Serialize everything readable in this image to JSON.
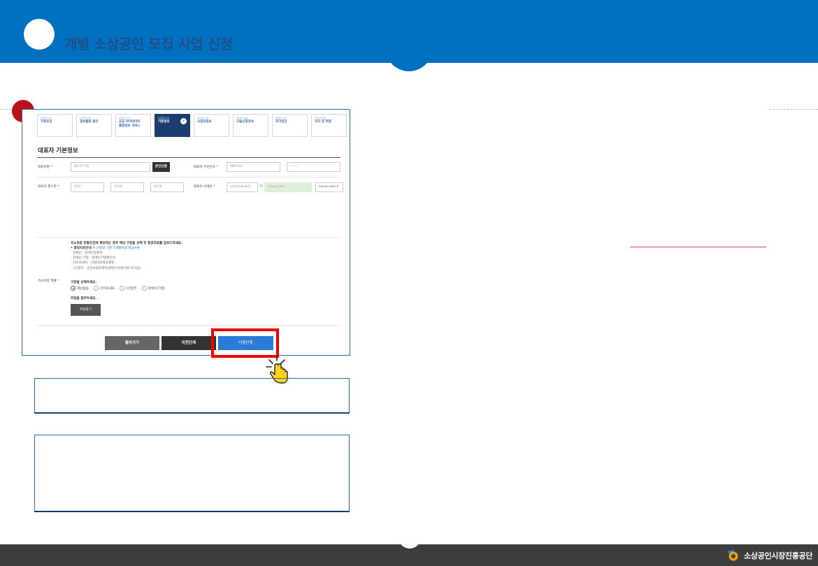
{
  "header": {
    "title": "개별 소상공인 모집 사업 신청"
  },
  "steps": [
    {
      "num": "STEP 01",
      "name": "기본요건"
    },
    {
      "num": "STEP 02",
      "name": "정보활용 동의"
    },
    {
      "num": "STEP 03",
      "name": "공공 마이데이터",
      "name2": "통합정보 서비스"
    },
    {
      "num": "STEP 04",
      "name": "기본정보"
    },
    {
      "num": "STEP 05",
      "name": "사업장정보"
    },
    {
      "num": "STEP 06",
      "name": "기술신청정보"
    },
    {
      "num": "STEP 07",
      "name": "자가진단"
    },
    {
      "num": "STEP 08",
      "name": "의지 및 역량"
    }
  ],
  "form": {
    "section_title": "대표자 기본정보",
    "name_label": "대표자명 *",
    "name_value": "테스트기업",
    "verify_button": "본인인증",
    "ssn_label": "대표자 주민번호 *",
    "ssn_front": "980702",
    "ssn_back": "-------",
    "phone_label": "대표자 핸드폰 *",
    "phone_1": "010",
    "phone_2": "1234",
    "phone_3": "5678",
    "email_label": "대표자 이메일 *",
    "email_id": "a1b2b3b4b5",
    "email_at": "@",
    "email_domain": "naver.com",
    "email_select": "naver.com ▾",
    "benefit_label": "저소득층 현황 *",
    "notice_title": "저소득층 현황조건에 해당하는 경우 해당 구분을 선택 후 증빙자료를 업로드하세요.",
    "notice_doc_prefix": "• 증빙자료안내",
    "notice_doc_link": "※ 신청일 기준 1개월이내 발급서류",
    "notice_items": [
      "- 장애인 : 장애인증명서",
      "- 장애인 기업 : 장애인기업확인서",
      "- 간이과세자 : 사업자등록증명원",
      "- 1인업주 : 건강보험자격득실확인서(본인외 미가입)"
    ],
    "choose_label": "구분을 선택하세요.",
    "radio_options": [
      "해당없음",
      "간이과세자",
      "1인업주",
      "장애인(기업)"
    ],
    "attach_label": "파일을 첨부하세요.",
    "file_button": "파일찾기"
  },
  "footer_buttons": {
    "back": "돌아가기",
    "prev": "이전단계",
    "next": "다음단계"
  },
  "bottom": {
    "logo_text": "소상공인시장진흥공단"
  },
  "colors": {
    "primary": "#0070c0",
    "accent_red": "#b8121b",
    "highlight": "#ee0000",
    "step_active": "#1a3c6e"
  }
}
